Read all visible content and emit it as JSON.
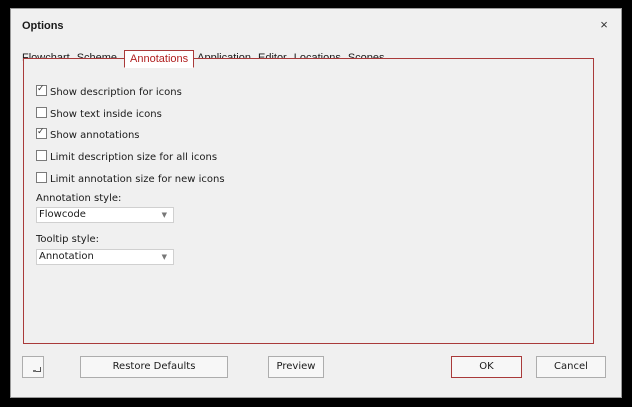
{
  "window": {
    "title": "Options",
    "close_label": "×"
  },
  "tabs": [
    {
      "label": "Flowchart",
      "active": false
    },
    {
      "label": "Scheme",
      "active": false
    },
    {
      "label": "Annotations",
      "active": true
    },
    {
      "label": "Application",
      "active": false
    },
    {
      "label": "Editor",
      "active": false
    },
    {
      "label": "Locations",
      "active": false
    },
    {
      "label": "Scopes",
      "active": false
    }
  ],
  "annotations": {
    "options": [
      {
        "label": "Show description for icons",
        "checked": true
      },
      {
        "label": "Show text inside icons",
        "checked": false
      },
      {
        "label": "Show annotations",
        "checked": true
      },
      {
        "label": "Limit description size for all icons",
        "checked": false
      },
      {
        "label": "Limit annotation size for new icons",
        "checked": false
      }
    ],
    "annotation_style": {
      "label": "Annotation style:",
      "value": "Flowcode"
    },
    "tooltip_style": {
      "label": "Tooltip style:",
      "value": "Annotation"
    }
  },
  "buttons": {
    "restore_defaults": "Restore Defaults",
    "preview": "Preview",
    "ok": "OK",
    "cancel": "Cancel"
  },
  "icons": {
    "check": "✓",
    "dropdown": "▼",
    "resize": "resize-grip-icon"
  },
  "colors": {
    "accent": "#a93a3a",
    "active_tab_text": "#b01e1e",
    "dialog_bg": "#f0f0f0",
    "outer_bg": "#000000"
  }
}
